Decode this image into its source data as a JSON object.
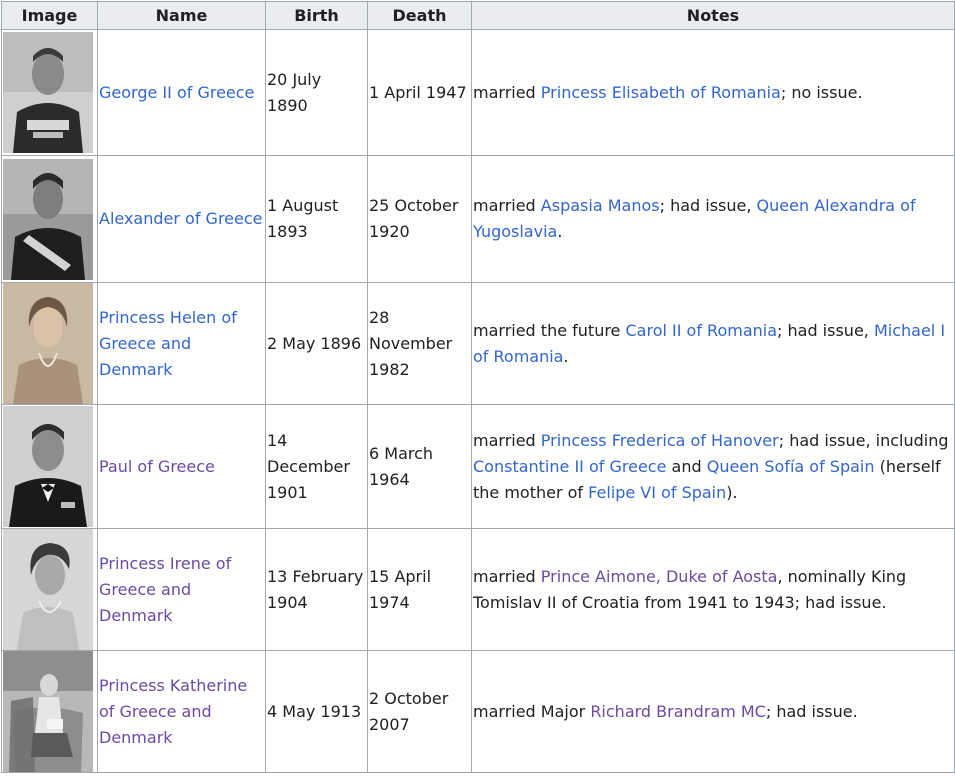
{
  "headers": {
    "image": "Image",
    "name": "Name",
    "birth": "Birth",
    "death": "Death",
    "notes": "Notes"
  },
  "rows": [
    {
      "name": "George II of Greece",
      "birth": "20 July 1890",
      "death": "1 April 1947",
      "notes": {
        "t1": "married ",
        "l1": "Princess Elisabeth of Romania",
        "t2": "; no issue."
      }
    },
    {
      "name": "Alexander of Greece",
      "birth": "1 August 1893",
      "death": "25 October 1920",
      "notes": {
        "t1": "married ",
        "l1": "Aspasia Manos",
        "t2": "; had issue, ",
        "l2": "Queen Alexandra of Yugoslavia",
        "t3": "."
      }
    },
    {
      "name": "Princess Helen of Greece and Denmark",
      "birth": "2 May 1896",
      "death": "28 November 1982",
      "notes": {
        "t1": "married the future ",
        "l1": "Carol II of Romania",
        "t2": "; had issue, ",
        "l2": "Michael I of Romania",
        "t3": "."
      }
    },
    {
      "name": "Paul of Greece",
      "birth": "14 December 1901",
      "death": "6 March 1964",
      "notes": {
        "t1": "married ",
        "l1": "Princess Frederica of Hanover",
        "t2": "; had issue, including ",
        "l2": "Constantine II of Greece",
        "t3": " and ",
        "l3": "Queen Sofía of Spain",
        "t4": " (herself the mother of ",
        "l4": "Felipe VI of Spain",
        "t5": ")."
      }
    },
    {
      "name": "Princess Irene of Greece and Denmark",
      "birth": "13 February 1904",
      "death": "15 April 1974",
      "notes": {
        "t1": "married ",
        "l1": "Prince Aimone, Duke of Aosta",
        "t2": ", nominally King Tomislav II of Croatia from 1941 to 1943; had issue."
      }
    },
    {
      "name": "Princess Katherine of Greece and Denmark",
      "birth": "4 May 1913",
      "death": "2 October 2007",
      "notes": {
        "t1": "married Major ",
        "l1": "Richard Brandram MC",
        "t2": "; had issue."
      }
    }
  ]
}
